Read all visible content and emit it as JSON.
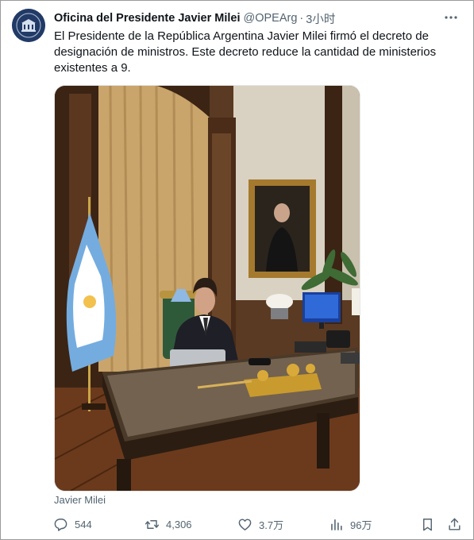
{
  "tweet": {
    "author_name": "Oficina del Presidente Javier Milei",
    "handle": "@OPEArg",
    "separator": "·",
    "time": "3小时",
    "text": "El Presidente de la República Argentina Javier Milei firmó el decreto de designación de ministros. Este decreto reduce la cantidad de ministerios existentes a 9.",
    "media_caption": "Javier Milei"
  },
  "actions": {
    "replies": "544",
    "retweets": "4,306",
    "likes": "3.7万",
    "views": "96万"
  },
  "icons": {
    "more": "more-icon",
    "reply": "reply-icon",
    "retweet": "retweet-icon",
    "like": "heart-icon",
    "views": "views-icon",
    "bookmark": "bookmark-icon",
    "share": "share-icon"
  },
  "colors": {
    "text_primary": "#0f1419",
    "text_secondary": "#536471",
    "avatar_bg": "#223a66"
  }
}
